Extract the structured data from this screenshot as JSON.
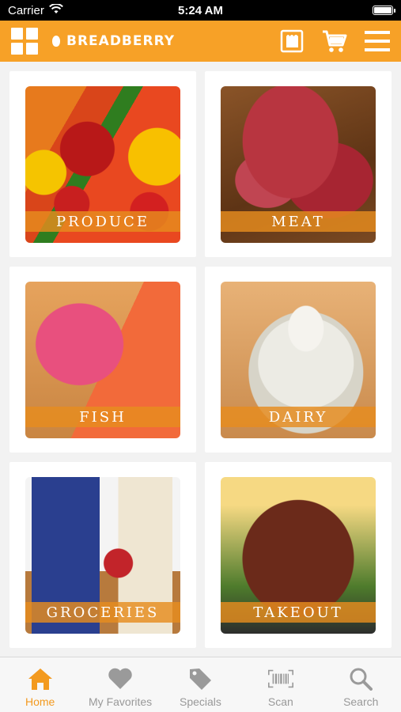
{
  "status_bar": {
    "carrier": "Carrier",
    "time": "5:24 AM"
  },
  "header": {
    "brand_name": "BREADBERRY",
    "left_icon": "grid-menu-icon",
    "actions": [
      "store-icon",
      "cart-icon",
      "hamburger-menu-icon"
    ],
    "color": "#f7a127"
  },
  "categories": [
    {
      "label": "PRODUCE"
    },
    {
      "label": "MEAT"
    },
    {
      "label": "FISH"
    },
    {
      "label": "DAIRY"
    },
    {
      "label": "GROCERIES"
    },
    {
      "label": "TAKEOUT"
    }
  ],
  "tab_bar": {
    "items": [
      {
        "label": "Home",
        "icon": "home-icon",
        "active": true
      },
      {
        "label": "My Favorites",
        "icon": "heart-icon",
        "active": false
      },
      {
        "label": "Specials",
        "icon": "tag-icon",
        "active": false
      },
      {
        "label": "Scan",
        "icon": "barcode-icon",
        "active": false
      },
      {
        "label": "Search",
        "icon": "search-icon",
        "active": false
      }
    ],
    "active_color": "#f39a1f",
    "inactive_color": "#999999"
  }
}
